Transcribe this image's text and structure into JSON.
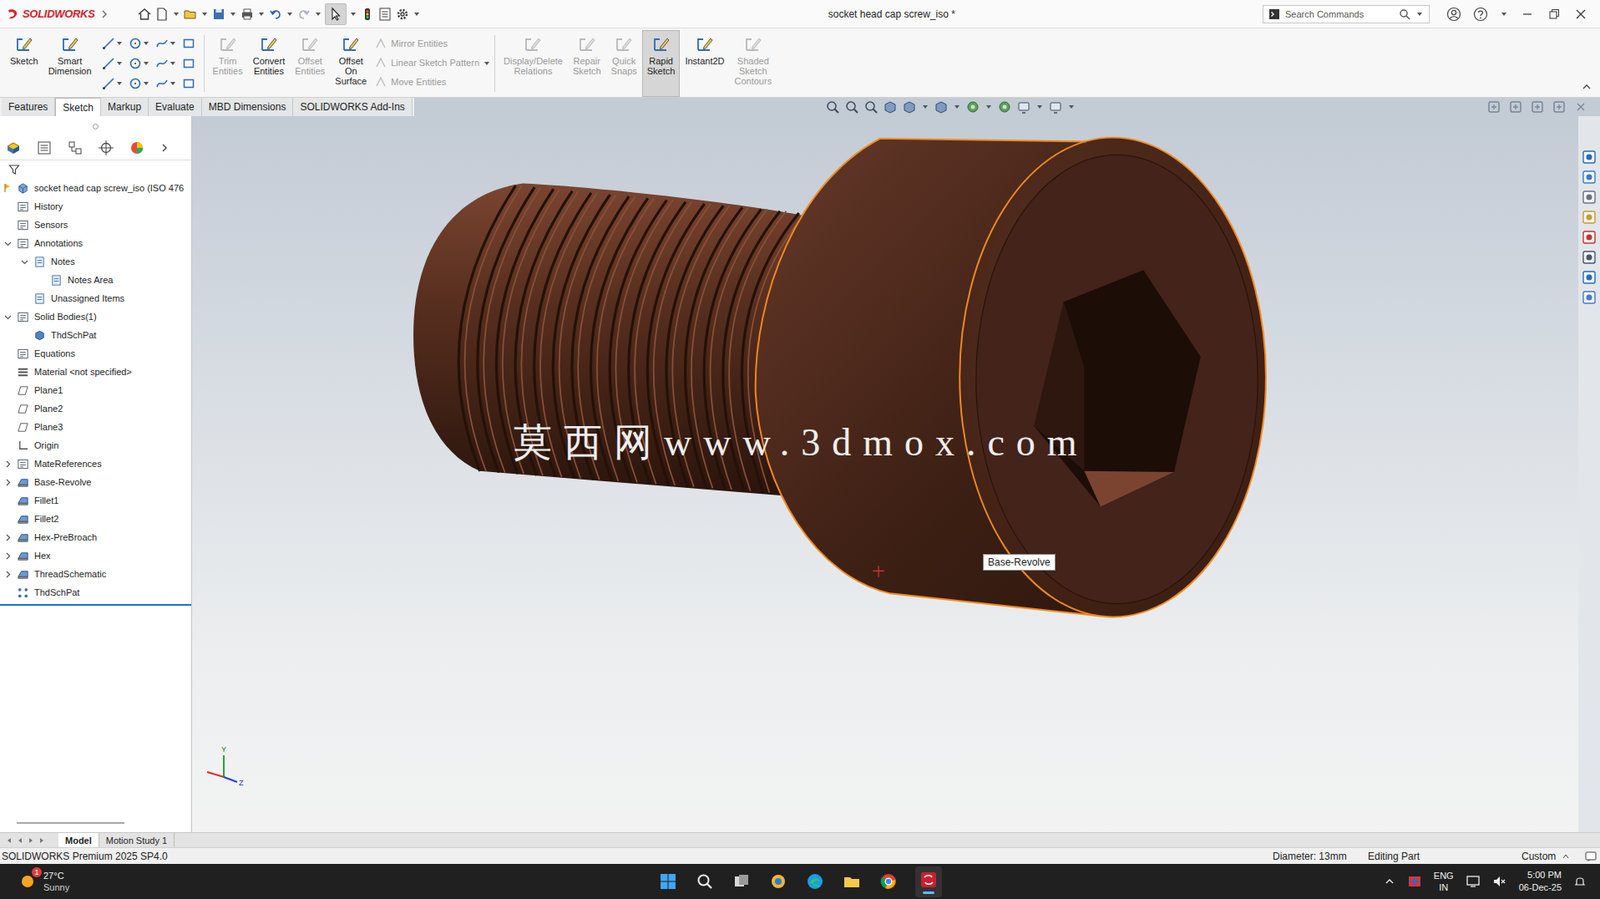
{
  "window": {
    "app": "SOLIDWORKS",
    "title": "socket head cap screw_iso *"
  },
  "toolbar": {
    "select_pressed": true
  },
  "search": {
    "placeholder": "Search Commands"
  },
  "ribbon": [
    {
      "kind": "large",
      "lines": [
        "Sketch"
      ],
      "disabled": false,
      "selected": false
    },
    {
      "kind": "large",
      "lines": [
        "Smart",
        "Dimension"
      ],
      "disabled": false,
      "selected": false
    },
    {
      "kind": "tools"
    },
    {
      "kind": "large",
      "lines": [
        "Trim",
        "Entities"
      ],
      "disabled": true,
      "selected": false
    },
    {
      "kind": "large",
      "lines": [
        "Convert",
        "Entities"
      ],
      "disabled": false,
      "selected": false
    },
    {
      "kind": "large",
      "lines": [
        "Offset",
        "Entities"
      ],
      "disabled": true,
      "selected": false
    },
    {
      "kind": "large",
      "lines": [
        "Offset",
        "On",
        "Surface"
      ],
      "disabled": false,
      "selected": false
    },
    {
      "kind": "list",
      "items": [
        {
          "label": "Mirror Entities",
          "disabled": true
        },
        {
          "label": "Linear Sketch Pattern",
          "disabled": true
        },
        {
          "label": "Move Entities",
          "disabled": true
        }
      ]
    },
    {
      "kind": "large",
      "lines": [
        "Display/Delete",
        "Relations"
      ],
      "disabled": true,
      "selected": false
    },
    {
      "kind": "large",
      "lines": [
        "Repair",
        "Sketch"
      ],
      "disabled": true,
      "selected": false
    },
    {
      "kind": "large",
      "lines": [
        "Quick",
        "Snaps"
      ],
      "disabled": true,
      "selected": false
    },
    {
      "kind": "large",
      "lines": [
        "Rapid",
        "Sketch"
      ],
      "disabled": false,
      "selected": true
    },
    {
      "kind": "large",
      "lines": [
        "Instant2D"
      ],
      "disabled": false,
      "selected": false
    },
    {
      "kind": "large",
      "lines": [
        "Shaded",
        "Sketch",
        "Contours"
      ],
      "disabled": true,
      "selected": false
    }
  ],
  "tabs": [
    {
      "label": "Features",
      "selected": false
    },
    {
      "label": "Sketch",
      "selected": true
    },
    {
      "label": "Markup",
      "selected": false
    },
    {
      "label": "Evaluate",
      "selected": false
    },
    {
      "label": "MBD Dimensions",
      "selected": false
    },
    {
      "label": "SOLIDWORKS Add-Ins",
      "selected": false
    }
  ],
  "tree": [
    {
      "label": "socket head cap screw_iso (ISO 476",
      "level": 1,
      "kind": "part",
      "expandable": false,
      "expanded": false
    },
    {
      "label": "History",
      "level": 1,
      "kind": "folder",
      "expandable": false,
      "expanded": false
    },
    {
      "label": "Sensors",
      "level": 1,
      "kind": "folder",
      "expandable": false,
      "expanded": false
    },
    {
      "label": "Annotations",
      "level": 1,
      "kind": "folder",
      "expandable": true,
      "expanded": true
    },
    {
      "label": "Notes",
      "level": 2,
      "kind": "notes",
      "expandable": true,
      "expanded": true
    },
    {
      "label": "Notes Area",
      "level": 3,
      "kind": "notes",
      "expandable": false,
      "expanded": false
    },
    {
      "label": "Unassigned Items",
      "level": 2,
      "kind": "notes",
      "expandable": false,
      "expanded": false
    },
    {
      "label": "Solid Bodies(1)",
      "level": 1,
      "kind": "folder",
      "expandable": true,
      "expanded": true
    },
    {
      "label": "ThdSchPat",
      "level": 2,
      "kind": "solid",
      "expandable": false,
      "expanded": false
    },
    {
      "label": "Equations",
      "level": 1,
      "kind": "folder",
      "expandable": false,
      "expanded": false
    },
    {
      "label": "Material <not specified>",
      "level": 1,
      "kind": "material",
      "expandable": false,
      "expanded": false
    },
    {
      "label": "Plane1",
      "level": 1,
      "kind": "plane",
      "expandable": false,
      "expanded": false
    },
    {
      "label": "Plane2",
      "level": 1,
      "kind": "plane",
      "expandable": false,
      "expanded": false
    },
    {
      "label": "Plane3",
      "level": 1,
      "kind": "plane",
      "expandable": false,
      "expanded": false
    },
    {
      "label": "Origin",
      "level": 1,
      "kind": "origin",
      "expandable": false,
      "expanded": false
    },
    {
      "label": "MateReferences",
      "level": 1,
      "kind": "folder",
      "expandable": true,
      "expanded": false
    },
    {
      "label": "Base-Revolve",
      "level": 1,
      "kind": "feature",
      "expandable": true,
      "expanded": false
    },
    {
      "label": "Fillet1",
      "level": 1,
      "kind": "feature",
      "expandable": false,
      "expanded": false
    },
    {
      "label": "Fillet2",
      "level": 1,
      "kind": "feature",
      "expandable": false,
      "expanded": false
    },
    {
      "label": "Hex-PreBroach",
      "level": 1,
      "kind": "feature",
      "expandable": true,
      "expanded": false
    },
    {
      "label": "Hex",
      "level": 1,
      "kind": "feature",
      "expandable": true,
      "expanded": false
    },
    {
      "label": "ThreadSchematic",
      "level": 1,
      "kind": "feature",
      "expandable": true,
      "expanded": false
    },
    {
      "label": "ThdSchPat",
      "level": 1,
      "kind": "pattern",
      "expandable": false,
      "expanded": false
    }
  ],
  "graphics": {
    "watermark": "莫西网www.3dmox.com",
    "tooltip": "Base-Revolve",
    "triad": {
      "y": "Y",
      "z": "Z"
    }
  },
  "model_tabs": [
    {
      "label": "Model",
      "selected": true
    },
    {
      "label": "Motion Study 1",
      "selected": false
    }
  ],
  "status_bar": {
    "product": "SOLIDWORKS Premium 2025 SP4.0",
    "measure": "Diameter: 13mm",
    "mode": "Editing Part",
    "units": "Custom"
  },
  "taskbar": {
    "weather": {
      "temp": "27°C",
      "condition": "Sunny",
      "badge": "1"
    },
    "language": [
      "ENG",
      "IN"
    ],
    "time": "5:00 PM",
    "date": "06-Dec-25"
  }
}
